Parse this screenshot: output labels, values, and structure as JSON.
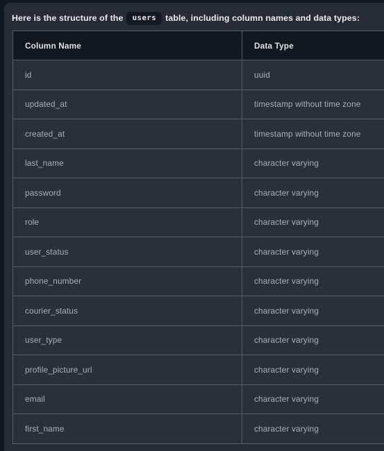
{
  "intro": {
    "before_code": "Here is the structure of the",
    "code": "users",
    "after_code": "table, including column names and data types:"
  },
  "table": {
    "headers": [
      "Column Name",
      "Data Type"
    ],
    "rows": [
      {
        "column_name": "id",
        "data_type": "uuid"
      },
      {
        "column_name": "updated_at",
        "data_type": "timestamp without time zone"
      },
      {
        "column_name": "created_at",
        "data_type": "timestamp without time zone"
      },
      {
        "column_name": "last_name",
        "data_type": "character varying"
      },
      {
        "column_name": "password",
        "data_type": "character varying"
      },
      {
        "column_name": "role",
        "data_type": "character varying"
      },
      {
        "column_name": "user_status",
        "data_type": "character varying"
      },
      {
        "column_name": "phone_number",
        "data_type": "character varying"
      },
      {
        "column_name": "courier_status",
        "data_type": "character varying"
      },
      {
        "column_name": "user_type",
        "data_type": "character varying"
      },
      {
        "column_name": "profile_picture_url",
        "data_type": "character varying"
      },
      {
        "column_name": "email",
        "data_type": "character varying"
      },
      {
        "column_name": "first_name",
        "data_type": "character varying"
      }
    ]
  },
  "colors": {
    "page_background": "#12161e",
    "panel_background": "#262b36",
    "header_row_background": "#121820",
    "body_row_background": "#2a2f3a",
    "border": "#565c68",
    "heading_text": "#e9ebef",
    "body_text": "#a9b0bd",
    "code_chip_background": "#141820"
  }
}
